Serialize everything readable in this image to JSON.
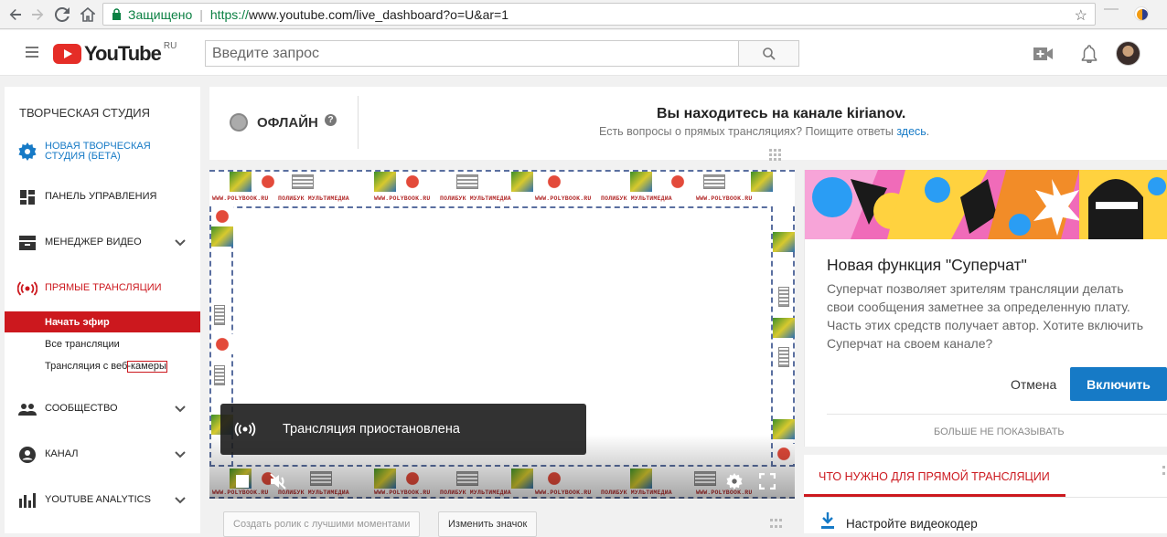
{
  "browser": {
    "secure_label": "Защищено",
    "url_proto": "https://",
    "url_rest": "www.youtube.com/live_dashboard?o=U&ar=1"
  },
  "masthead": {
    "logo_text": "YouTube",
    "logo_region": "RU",
    "search_placeholder": "Введите запрос"
  },
  "sidebar": {
    "title": "ТВОРЧЕСКАЯ СТУДИЯ",
    "items": [
      {
        "label": "НОВАЯ ТВОРЧЕСКАЯ СТУДИЯ (БЕТА)",
        "icon": "gear-icon"
      },
      {
        "label": "ПАНЕЛЬ УПРАВЛЕНИЯ",
        "icon": "dashboard-icon"
      },
      {
        "label": "МЕНЕДЖЕР ВИДЕО",
        "icon": "video-manager-icon"
      },
      {
        "label": "ПРЯМЫЕ ТРАНСЛЯЦИИ",
        "icon": "live-broadcast-icon"
      },
      {
        "label": "СООБЩЕСТВО",
        "icon": "community-icon"
      },
      {
        "label": "КАНАЛ",
        "icon": "channel-icon"
      },
      {
        "label": "YOUTUBE ANALYTICS",
        "icon": "analytics-icon"
      }
    ],
    "subitems": [
      {
        "label": "Начать эфир"
      },
      {
        "label": "Все трансляции"
      },
      {
        "label": "Трансляция с веб-камеры"
      }
    ],
    "colors": {
      "active": "#cc181e",
      "new_studio": "#167ac6"
    }
  },
  "status": {
    "state": "ОФЛАЙН",
    "help": "?",
    "channel_message": "Вы находитесь на канале kirianov.",
    "faq_text": "Есть вопросы о прямых трансляциях? Поищите ответы",
    "faq_link": "здесь",
    "faq_end": "."
  },
  "player": {
    "toast": "Трансляция приостановлена",
    "watermark": "WWW.POLYBOOK.RU",
    "watermark2": "ПОЛИБУК МУЛЬТИМЕДИА"
  },
  "under_player": {
    "highlights_button": "Создать ролик с лучшими моментами",
    "thumbnail_button": "Изменить значок"
  },
  "superchat": {
    "title": "Новая функция \"Суперчат\"",
    "body": "Суперчат позволяет зрителям трансляции делать свои сообщения заметнее за определенную плату. Часть этих средств получает автор. Хотите включить Суперчат на своем канале?",
    "cancel": "Отмена",
    "enable": "Включить",
    "dont_show": "БОЛЬШЕ НЕ ПОКАЗЫВАТЬ",
    "accent": "#167ac6"
  },
  "requirements": {
    "tab": "ЧТО НУЖНО ДЛЯ ПРЯМОЙ ТРАНСЛЯЦИИ",
    "item": "Настройте видеокодер"
  }
}
